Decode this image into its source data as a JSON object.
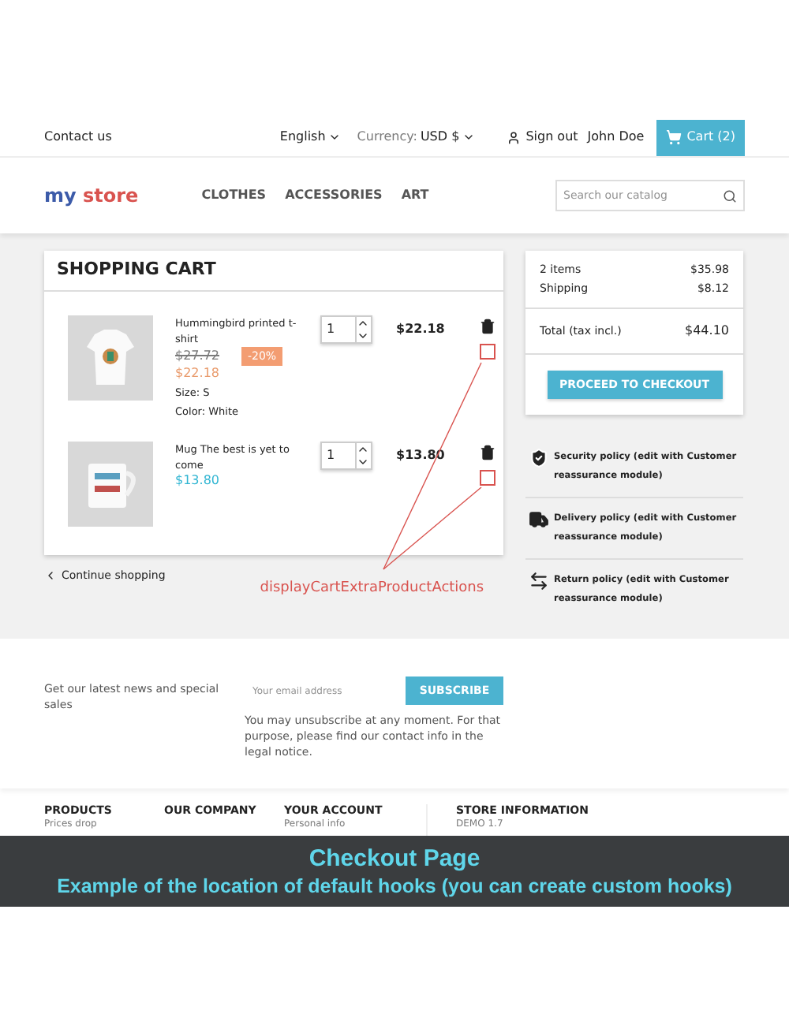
{
  "header": {
    "contact": "Contact us",
    "language": "English",
    "currency_label": "Currency:",
    "currency": "USD $",
    "sign_out": "Sign out",
    "user": "John Doe",
    "cart": "Cart (2)"
  },
  "nav": {
    "logo": [
      "my",
      "store"
    ],
    "categories": [
      "CLOTHES",
      "ACCESSORIES",
      "ART"
    ],
    "search_placeholder": "Search our catalog"
  },
  "cart": {
    "title": "SHOPPING CART",
    "items": [
      {
        "kind": "tshirt",
        "name": "Hummingbird printed t-shirt",
        "discounted": true,
        "old_price": "$27.72",
        "discount": "-20%",
        "price": "$22.18",
        "attributes": [
          {
            "label": "Size:",
            "value": "S"
          },
          {
            "label": "Color:",
            "value": "White"
          }
        ],
        "qty": "1",
        "total": "$22.18"
      },
      {
        "kind": "mug",
        "name": "Mug The best is yet to come",
        "discounted": false,
        "price": "$13.80",
        "qty": "1",
        "total": "$13.80"
      }
    ],
    "continue": "Continue shopping"
  },
  "annotation": "displayCartExtraProductActions",
  "summary": {
    "lines": [
      {
        "label": "2 items",
        "value": "$35.98"
      },
      {
        "label": "Shipping",
        "value": "$8.12"
      }
    ],
    "total_label": "Total (tax incl.)",
    "total": "$44.10",
    "checkout": "PROCEED TO CHECKOUT"
  },
  "reassurance": [
    {
      "kind": "shield",
      "text": "Security policy (edit with Customer reassurance module)"
    },
    {
      "kind": "truck",
      "text": "Delivery policy (edit with Customer reassurance module)"
    },
    {
      "kind": "arrows",
      "text": "Return policy (edit with Customer reassurance module)"
    }
  ],
  "newsletter": {
    "text": "Get our latest news and special sales",
    "placeholder": "Your email address",
    "button": "SUBSCRIBE",
    "note": "You may unsubscribe at any moment. For that purpose, please find our contact info in the legal notice."
  },
  "footer": [
    {
      "title": "PRODUCTS",
      "items": [
        "Prices drop"
      ]
    },
    {
      "title": "OUR COMPANY"
    },
    {
      "title": "YOUR ACCOUNT",
      "items": [
        "Personal info"
      ]
    },
    {
      "title": "STORE INFORMATION",
      "items": [
        "DEMO 1.7"
      ]
    }
  ],
  "banner": {
    "title": "Checkout Page",
    "subtitle": "Example of the location of default hooks (you can create custom hooks)"
  }
}
